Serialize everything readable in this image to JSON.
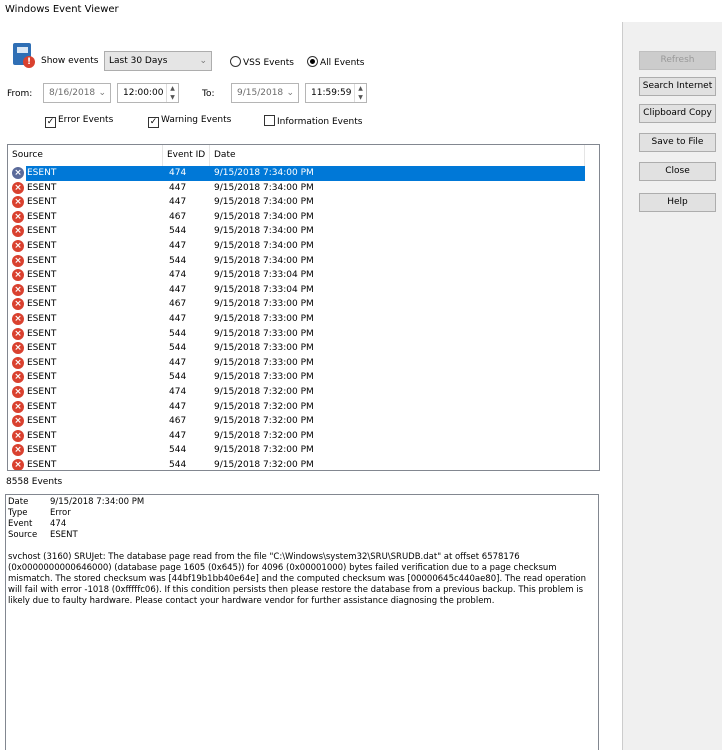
{
  "window": {
    "title": "Windows Event Viewer"
  },
  "filters": {
    "show_events_label": "Show events",
    "range": "Last 30 Days",
    "vss_label": "VSS Events",
    "all_label": "All Events",
    "selected_radio": "All Events",
    "from_label": "From:",
    "from_date": "8/16/2018",
    "from_time": "12:00:00 AM",
    "to_label": "To:",
    "to_date": "9/15/2018",
    "to_time": "11:59:59 PM",
    "error_label": "Error Events",
    "error_checked": true,
    "warning_label": "Warning Events",
    "warning_checked": true,
    "info_label": "Information Events",
    "info_checked": false
  },
  "buttons": {
    "refresh": "Refresh",
    "search": "Search Internet",
    "clipboard": "Clipboard Copy",
    "save": "Save to File",
    "close": "Close",
    "help": "Help"
  },
  "list": {
    "columns": [
      "Source",
      "Event ID",
      "Date"
    ],
    "rows": [
      {
        "source": "ESENT",
        "id": "474",
        "date": "9/15/2018 7:34:00 PM",
        "selected": true
      },
      {
        "source": "ESENT",
        "id": "447",
        "date": "9/15/2018 7:34:00 PM"
      },
      {
        "source": "ESENT",
        "id": "447",
        "date": "9/15/2018 7:34:00 PM"
      },
      {
        "source": "ESENT",
        "id": "467",
        "date": "9/15/2018 7:34:00 PM"
      },
      {
        "source": "ESENT",
        "id": "544",
        "date": "9/15/2018 7:34:00 PM"
      },
      {
        "source": "ESENT",
        "id": "447",
        "date": "9/15/2018 7:34:00 PM"
      },
      {
        "source": "ESENT",
        "id": "544",
        "date": "9/15/2018 7:34:00 PM"
      },
      {
        "source": "ESENT",
        "id": "474",
        "date": "9/15/2018 7:33:04 PM"
      },
      {
        "source": "ESENT",
        "id": "447",
        "date": "9/15/2018 7:33:04 PM"
      },
      {
        "source": "ESENT",
        "id": "467",
        "date": "9/15/2018 7:33:00 PM"
      },
      {
        "source": "ESENT",
        "id": "447",
        "date": "9/15/2018 7:33:00 PM"
      },
      {
        "source": "ESENT",
        "id": "544",
        "date": "9/15/2018 7:33:00 PM"
      },
      {
        "source": "ESENT",
        "id": "544",
        "date": "9/15/2018 7:33:00 PM"
      },
      {
        "source": "ESENT",
        "id": "447",
        "date": "9/15/2018 7:33:00 PM"
      },
      {
        "source": "ESENT",
        "id": "544",
        "date": "9/15/2018 7:33:00 PM"
      },
      {
        "source": "ESENT",
        "id": "474",
        "date": "9/15/2018 7:32:00 PM"
      },
      {
        "source": "ESENT",
        "id": "447",
        "date": "9/15/2018 7:32:00 PM"
      },
      {
        "source": "ESENT",
        "id": "467",
        "date": "9/15/2018 7:32:00 PM"
      },
      {
        "source": "ESENT",
        "id": "447",
        "date": "9/15/2018 7:32:00 PM"
      },
      {
        "source": "ESENT",
        "id": "544",
        "date": "9/15/2018 7:32:00 PM"
      },
      {
        "source": "ESENT",
        "id": "544",
        "date": "9/15/2018 7:32:00 PM"
      }
    ]
  },
  "count": "8558 Events",
  "detail": {
    "date_label": "Date",
    "date": "9/15/2018 7:34:00 PM",
    "type_label": "Type",
    "type": "Error",
    "event_label": "Event",
    "event": "474",
    "source_label": "Source",
    "source": "ESENT",
    "message": "svchost (3160) SRUJet: The database page read from the file \"C:\\Windows\\system32\\SRU\\SRUDB.dat\" at offset 6578176 (0x0000000000646000) (database page 1605 (0x645)) for 4096 (0x00001000) bytes failed verification due to a page checksum mismatch. The stored checksum was [44bf19b1bb40e64e] and the computed checksum was [00000645c440ae80].  The read operation will fail with error -1018 (0xfffffc06).  If this condition persists then please restore the database from a previous backup.  This problem is likely due to faulty hardware. Please contact your hardware vendor for further assistance diagnosing the problem."
  },
  "colors": {
    "selection": "#0078d7",
    "error_icon": "#d9412f"
  }
}
